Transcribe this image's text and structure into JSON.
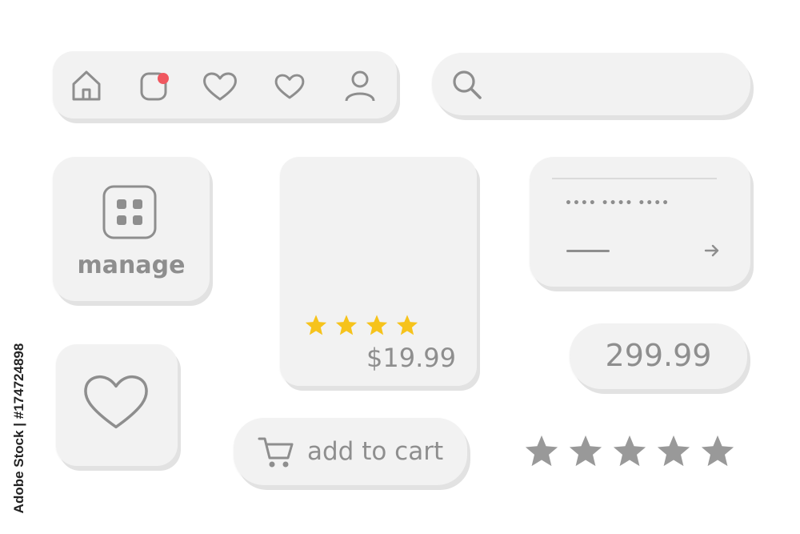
{
  "nav_bar": {
    "icons": [
      "home-icon",
      "notification-icon",
      "heart-icon",
      "heart-outline-icon",
      "user-icon"
    ],
    "badge_color": "#f0575f"
  },
  "search": {
    "icon": "search-icon"
  },
  "manage_tile": {
    "label": "manage",
    "icon": "grid-icon"
  },
  "product_card": {
    "price": "$19.99",
    "rating": 4,
    "star_color": "#f6c31c"
  },
  "card_widget": {
    "number_mask": "•••• •••• ••••",
    "arrow_icon": "arrow-right-icon"
  },
  "price_pill": {
    "value": "299.99"
  },
  "rating_row": {
    "rating": 5,
    "star_color": "#999999"
  },
  "cart_button": {
    "label": "add to cart",
    "icon": "cart-icon"
  },
  "watermark": {
    "side_text": "Adobe Stock | #174724898"
  }
}
